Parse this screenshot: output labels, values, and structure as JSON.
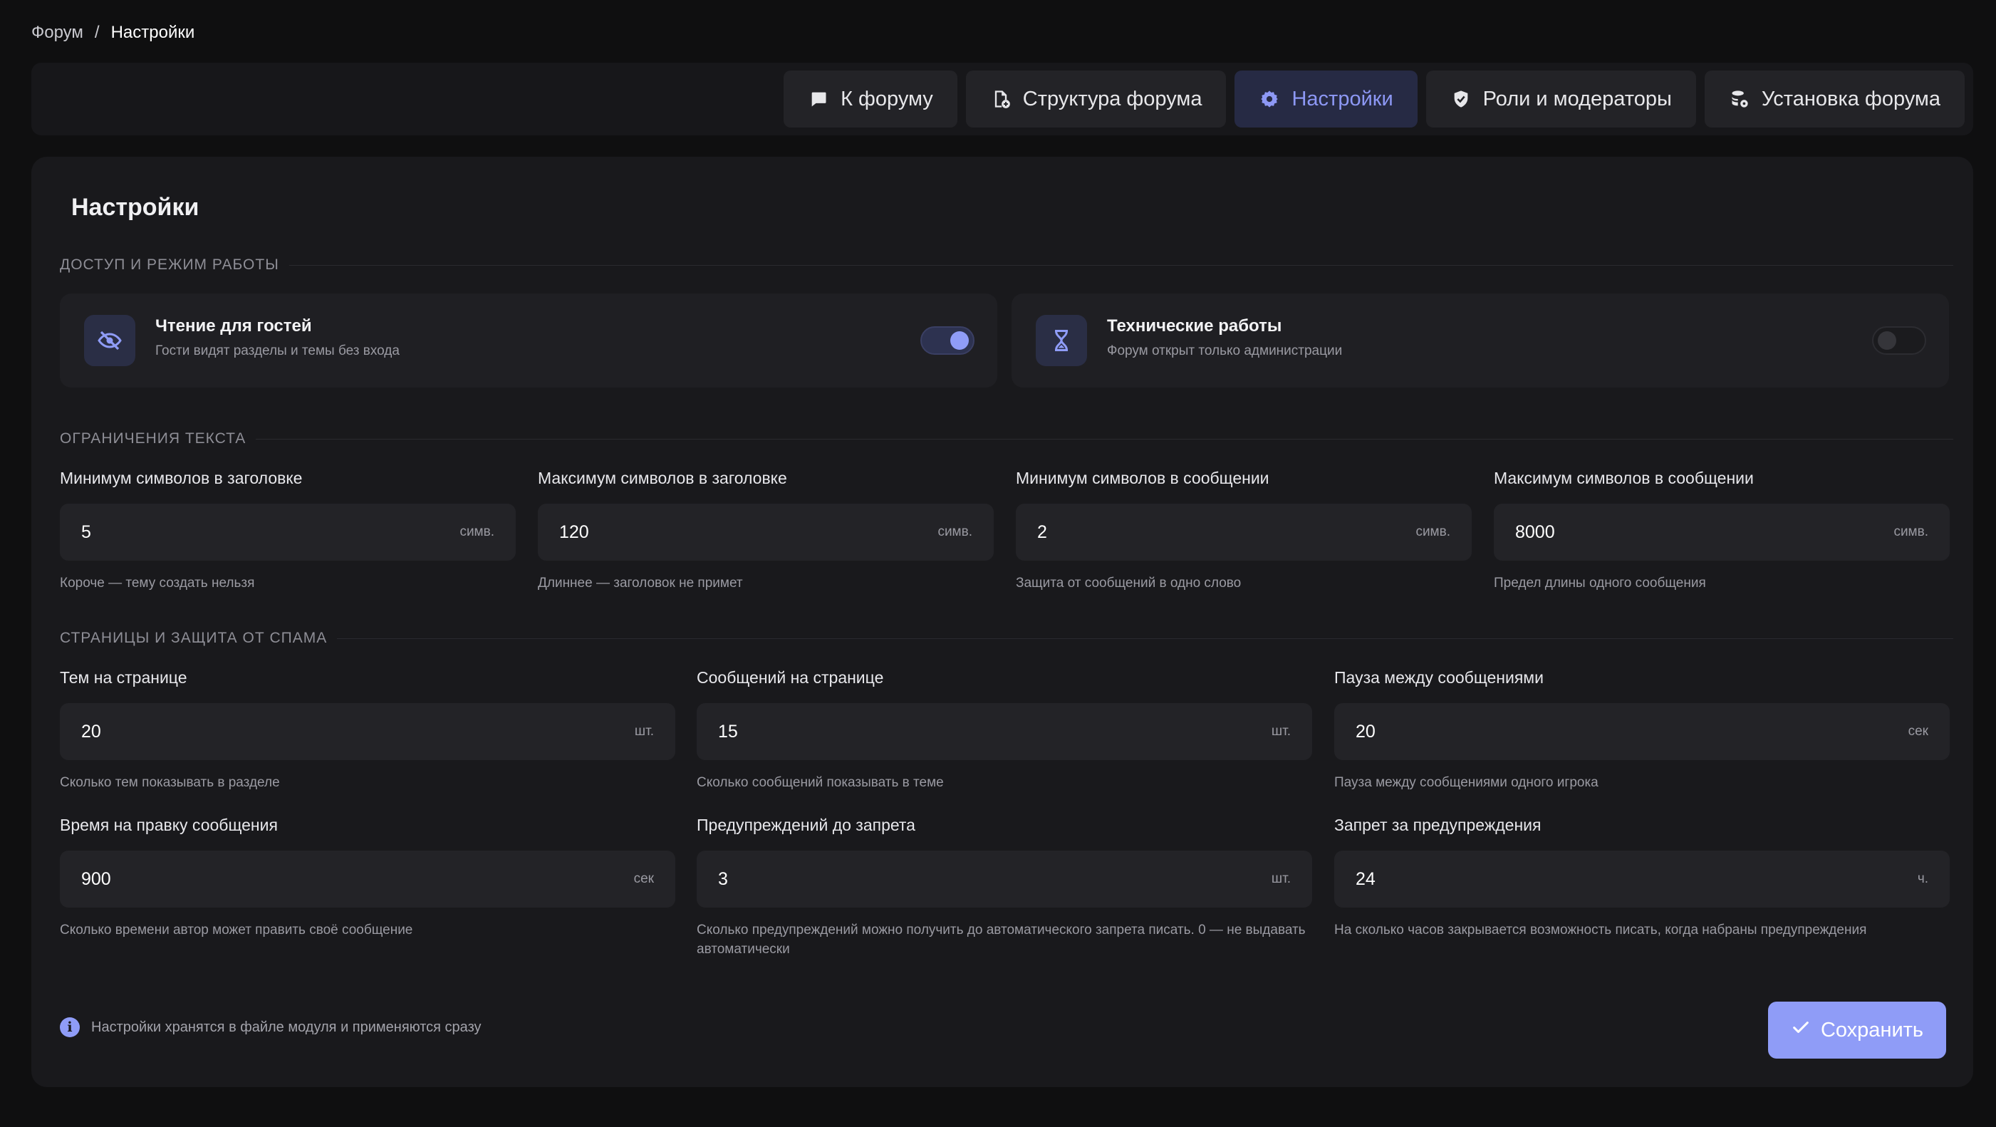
{
  "breadcrumb": {
    "root": "Форум",
    "separator": "/",
    "current": "Настройки"
  },
  "nav": [
    {
      "label": "К форуму",
      "icon": "chat-bubble-icon"
    },
    {
      "label": "Структура форума",
      "icon": "file-add-icon"
    },
    {
      "label": "Настройки",
      "icon": "gear-icon",
      "active": true
    },
    {
      "label": "Роли и модераторы",
      "icon": "shield-check-icon"
    },
    {
      "label": "Установка форума",
      "icon": "database-settings-icon"
    }
  ],
  "card": {
    "title": "Настройки"
  },
  "sections": {
    "access": "ДОСТУП И РЕЖИМ РАБОТЫ",
    "text_limits": "ОГРАНИЧЕНИЯ ТЕКСТА",
    "pages_spam": "СТРАНИЦЫ И ЗАЩИТА ОТ СПАМА"
  },
  "toggles": {
    "guests": {
      "title": "Чтение для гостей",
      "subtitle": "Гости видят разделы и темы без входа",
      "icon": "eye-off-icon",
      "on": true
    },
    "maintenance": {
      "title": "Технические работы",
      "subtitle": "Форум открыт только администрации",
      "icon": "hourglass-icon",
      "on": false
    }
  },
  "text_fields": [
    {
      "label": "Минимум символов в заголовке",
      "value": "5",
      "unit": "симв.",
      "help": "Короче — тему создать нельзя"
    },
    {
      "label": "Максимум символов в заголовке",
      "value": "120",
      "unit": "симв.",
      "help": "Длиннее — заголовок не примет"
    },
    {
      "label": "Минимум символов в сообщении",
      "value": "2",
      "unit": "симв.",
      "help": "Защита от сообщений в одно слово"
    },
    {
      "label": "Максимум символов в сообщении",
      "value": "8000",
      "unit": "симв.",
      "help": "Предел длины одного сообщения"
    }
  ],
  "spam_fields": [
    {
      "label": "Тем на странице",
      "value": "20",
      "unit": "шт.",
      "help": "Сколько тем показывать в разделе"
    },
    {
      "label": "Сообщений на странице",
      "value": "15",
      "unit": "шт.",
      "help": "Сколько сообщений показывать в теме"
    },
    {
      "label": "Пауза между сообщениями",
      "value": "20",
      "unit": "сек",
      "help": "Пауза между сообщениями одного игрока"
    },
    {
      "label": "Время на правку сообщения",
      "value": "900",
      "unit": "сек",
      "help": "Сколько времени автор может править своё сообщение"
    },
    {
      "label": "Предупреждений до запрета",
      "value": "3",
      "unit": "шт.",
      "help": "Сколько предупреждений можно получить до автоматического запрета писать. 0 — не выдавать автоматически"
    },
    {
      "label": "Запрет за предупреждения",
      "value": "24",
      "unit": "ч.",
      "help": "На сколько часов закрывается возможность писать, когда набраны предупреждения"
    }
  ],
  "footer": {
    "note": "Настройки хранятся в файле модуля и применяются сразу",
    "info_glyph": "i",
    "save_label": "Сохранить"
  },
  "colors": {
    "accent": "#8f9cf7",
    "background": "#0f0f10",
    "card": "#19191c"
  }
}
